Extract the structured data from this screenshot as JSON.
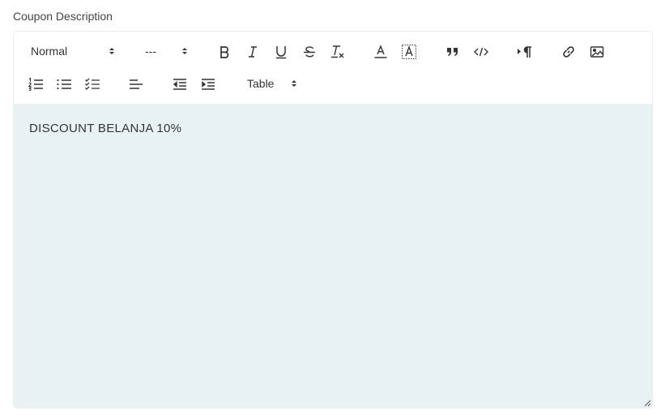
{
  "field": {
    "label": "Coupon Description"
  },
  "toolbar": {
    "heading_select": {
      "value": "Normal",
      "icon": "updown-arrows-icon"
    },
    "font_select": {
      "value": "---",
      "icon": "updown-arrows-icon"
    },
    "table_select": {
      "value": "Table",
      "icon": "updown-arrows-icon"
    },
    "buttons": [
      "bold-icon",
      "italic-icon",
      "underline-icon",
      "strikethrough-icon",
      "clear-format-icon",
      "font-color-icon",
      "highlight-color-icon",
      "blockquote-icon",
      "code-icon",
      "paragraph-direction-icon",
      "link-icon",
      "image-icon",
      "ordered-list-icon",
      "bullet-list-icon",
      "check-list-icon",
      "align-left-icon",
      "outdent-icon",
      "indent-icon"
    ]
  },
  "editor": {
    "content": "DISCOUNT BELANJA 10%",
    "background": "#e8f1f3"
  },
  "colors": {
    "text": "#333333",
    "border": "#dcdcdc"
  }
}
